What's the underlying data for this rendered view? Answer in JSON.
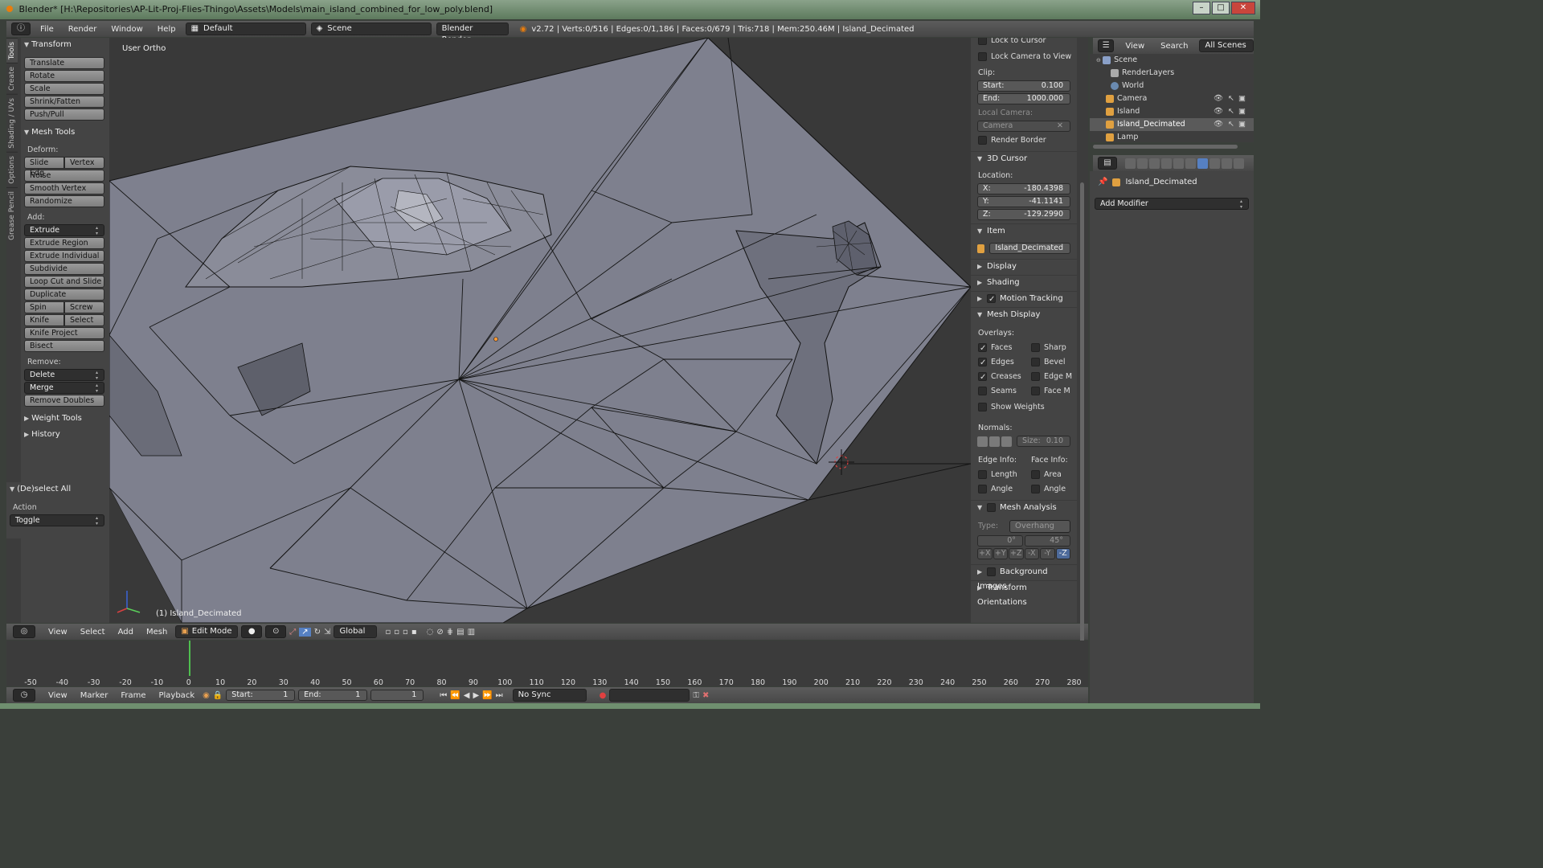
{
  "window": {
    "title": "Blender* [H:\\Repositories\\AP-Lit-Proj-Flies-Thingo\\Assets\\Models\\main_island_combined_for_low_poly.blend]"
  },
  "info_header": {
    "menus": [
      "File",
      "Render",
      "Window",
      "Help"
    ],
    "layout": "Default",
    "scene": "Scene",
    "engine": "Blender Render",
    "stats": "v2.72 | Verts:0/516 | Edges:0/1,186 | Faces:0/679 | Tris:718 | Mem:250.46M | Island_Decimated"
  },
  "tool_tabs": [
    "Tools",
    "Create",
    "Shading / UVs",
    "Options",
    "Grease Pencil"
  ],
  "toolshelf": {
    "transform_title": "Transform",
    "transform_buttons": [
      "Translate",
      "Rotate",
      "Scale",
      "Shrink/Fatten",
      "Push/Pull"
    ],
    "mesh_tools_title": "Mesh Tools",
    "deform_label": "Deform:",
    "slide_edge": "Slide Edg",
    "vertex": "Vertex",
    "noise": "Noise",
    "smooth_vertex": "Smooth Vertex",
    "randomize": "Randomize",
    "add_label": "Add:",
    "extrude": "Extrude",
    "extrude_region": "Extrude Region",
    "extrude_individual": "Extrude Individual",
    "subdivide": "Subdivide",
    "loop_cut": "Loop Cut and Slide",
    "duplicate": "Duplicate",
    "spin": "Spin",
    "screw": "Screw",
    "knife": "Knife",
    "select": "Select",
    "knife_project": "Knife Project",
    "bisect": "Bisect",
    "remove_label": "Remove:",
    "delete": "Delete",
    "merge": "Merge",
    "remove_doubles": "Remove Doubles",
    "weight_tools": "Weight Tools",
    "history": "History",
    "operator_title": "(De)select All",
    "action_label": "Action",
    "action_value": "Toggle"
  },
  "viewport": {
    "view_name": "User Ortho",
    "object_label": "(1) Island_Decimated"
  },
  "view3d_header": {
    "menus": [
      "View",
      "Select",
      "Add",
      "Mesh"
    ],
    "mode": "Edit Mode",
    "orientation": "Global"
  },
  "npanel": {
    "lock_cursor": "Lock to Cursor",
    "lock_camera": "Lock Camera to View",
    "clip_label": "Clip:",
    "clip_start_label": "Start:",
    "clip_start": "0.100",
    "clip_end_label": "End:",
    "clip_end": "1000.000",
    "local_camera_label": "Local Camera:",
    "camera_placeholder": "Camera",
    "render_border": "Render Border",
    "cursor_title": "3D Cursor",
    "location_label": "Location:",
    "x_label": "X:",
    "x": "-180.4398",
    "y_label": "Y:",
    "y": "-41.1141",
    "z_label": "Z:",
    "z": "-129.2990",
    "item_title": "Item",
    "item_name": "Island_Decimated",
    "display": "Display",
    "shading": "Shading",
    "motion_tracking": "Motion Tracking",
    "mesh_display": "Mesh Display",
    "overlays_label": "Overlays:",
    "overlays_left": [
      {
        "label": "Faces",
        "on": true
      },
      {
        "label": "Edges",
        "on": true
      },
      {
        "label": "Creases",
        "on": true
      },
      {
        "label": "Seams",
        "on": false
      }
    ],
    "overlays_right": [
      {
        "label": "Sharp",
        "on": false
      },
      {
        "label": "Bevel",
        "on": false
      },
      {
        "label": "Edge M",
        "on": false
      },
      {
        "label": "Face M",
        "on": false
      }
    ],
    "show_weights": "Show Weights",
    "normals_label": "Normals:",
    "size_label": "Size:",
    "size_value": "0.10",
    "edge_info_label": "Edge Info:",
    "face_info_label": "Face Info:",
    "length": "Length",
    "area": "Area",
    "angle": "Angle",
    "mesh_analysis": "Mesh Analysis",
    "type_label": "Type:",
    "type_value": "Overhang",
    "angle_min": "0°",
    "angle_max": "45°",
    "axes": [
      "+X",
      "+Y",
      "+Z",
      "-X",
      "-Y",
      "-Z"
    ],
    "background_images": "Background Images",
    "transform_orientations": "Transform Orientations"
  },
  "outliner": {
    "menus": [
      "View",
      "Search"
    ],
    "filter": "All Scenes",
    "rows": [
      {
        "label": "Scene",
        "indent": 0,
        "color": "#8aa0c8"
      },
      {
        "label": "RenderLayers",
        "indent": 2,
        "color": "#aaaaaa"
      },
      {
        "label": "World",
        "indent": 2,
        "color": "#6a8ab0"
      },
      {
        "label": "Camera",
        "indent": 1,
        "color": "#e0a040"
      },
      {
        "label": "Island",
        "indent": 1,
        "color": "#e0a040"
      },
      {
        "label": "Island_Decimated",
        "indent": 1,
        "color": "#e0a040",
        "selected": true
      },
      {
        "label": "Lamp",
        "indent": 1,
        "color": "#e0a040"
      }
    ]
  },
  "properties": {
    "object_name": "Island_Decimated",
    "add_modifier": "Add Modifier"
  },
  "timeline": {
    "ticks": [
      "-50",
      "-40",
      "-30",
      "-20",
      "-10",
      "0",
      "10",
      "20",
      "30",
      "40",
      "50",
      "60",
      "70",
      "80",
      "90",
      "100",
      "110",
      "120",
      "130",
      "140",
      "150",
      "160",
      "170",
      "180",
      "190",
      "200",
      "210",
      "220",
      "230",
      "240",
      "250",
      "260",
      "270",
      "280"
    ],
    "current_frame_value": 0,
    "menus": [
      "View",
      "Marker",
      "Frame",
      "Playback"
    ],
    "start_label": "Start:",
    "start": "1",
    "end_label": "End:",
    "end": "1",
    "current": "1",
    "sync": "No Sync"
  },
  "colors": {
    "accent_blue": "#5680c2",
    "mesh_fill": "#7d7f8d",
    "background": "#393939"
  }
}
